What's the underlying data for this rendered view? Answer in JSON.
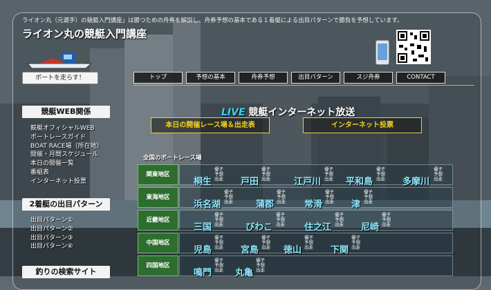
{
  "header": {
    "intro": "ライオン丸（元選手）の競艇入門講座」は勝つための舟券を解説し、舟券予想の基本である１着艇による出目パターンで勝負を予想しています。",
    "site_title": "ライオン丸の競艇入門講座",
    "run_button": "ボートを走らす！"
  },
  "nav": [
    "トップ",
    "予想の基本",
    "舟券予想",
    "出目パターン",
    "スジ舟券",
    "CONTACT"
  ],
  "sidebar": {
    "sections": [
      {
        "title": "競艇WEB関係",
        "items": [
          "競艇オフィシャルWEB",
          "ボートレースガイド",
          "BOAT RACE場（所在地）",
          "開催・月間スケジュール",
          "本日の開催一覧",
          "番組表",
          "インターネット投票"
        ]
      },
      {
        "title": "2着艇の出目パターン",
        "items": [
          "出目パターン①",
          "出目パターン②",
          "出目パターン③",
          "出目パターン④"
        ]
      },
      {
        "title": "釣りの検索サイト",
        "items": []
      }
    ]
  },
  "main": {
    "live_word": "LIVE",
    "live_rest": "競艇インターネット放送",
    "today_button": "本日の開催レース場＆出走表",
    "vote_button": "インターネット投票",
    "national_label": "全国のボートレース場",
    "tag_labels": [
      "優子",
      "予想",
      "出走",
      "展予"
    ],
    "regions": [
      {
        "name": "関東地区",
        "venues": [
          "桐生",
          "戸田",
          "江戸川",
          "平和島",
          "多摩川"
        ]
      },
      {
        "name": "東海地区",
        "venues": [
          "浜名湖",
          "蒲郡",
          "常滑",
          "津"
        ]
      },
      {
        "name": "近畿地区",
        "venues": [
          "三国",
          "びわこ",
          "住之江",
          "尼崎"
        ]
      },
      {
        "name": "中国地区",
        "venues": [
          "児島",
          "宮島",
          "徳山",
          "下関"
        ]
      },
      {
        "name": "四国地区",
        "venues": [
          "鳴門",
          "丸亀"
        ]
      }
    ]
  },
  "colors": {
    "accent_live": "#38d6f0",
    "venue_text": "#8ee7ff",
    "region_green": "#2d6e2f",
    "yellow": "#f3d21b"
  },
  "icons": [
    "boat-icon",
    "phone-icon",
    "qr-code-icon"
  ]
}
